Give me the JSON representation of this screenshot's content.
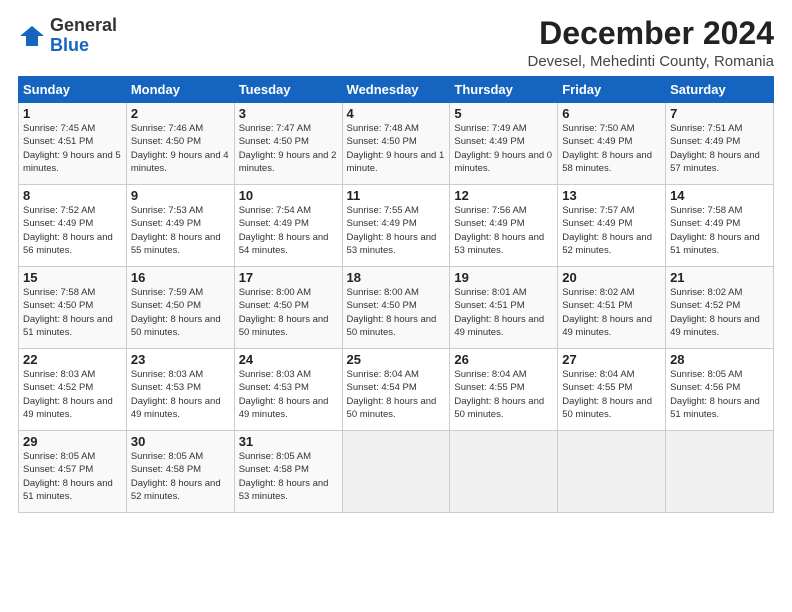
{
  "logo": {
    "general": "General",
    "blue": "Blue"
  },
  "title": "December 2024",
  "location": "Devesel, Mehedinti County, Romania",
  "weekdays": [
    "Sunday",
    "Monday",
    "Tuesday",
    "Wednesday",
    "Thursday",
    "Friday",
    "Saturday"
  ],
  "weeks": [
    [
      {
        "day": "1",
        "sunrise": "Sunrise: 7:45 AM",
        "sunset": "Sunset: 4:51 PM",
        "daylight": "Daylight: 9 hours and 5 minutes."
      },
      {
        "day": "2",
        "sunrise": "Sunrise: 7:46 AM",
        "sunset": "Sunset: 4:50 PM",
        "daylight": "Daylight: 9 hours and 4 minutes."
      },
      {
        "day": "3",
        "sunrise": "Sunrise: 7:47 AM",
        "sunset": "Sunset: 4:50 PM",
        "daylight": "Daylight: 9 hours and 2 minutes."
      },
      {
        "day": "4",
        "sunrise": "Sunrise: 7:48 AM",
        "sunset": "Sunset: 4:50 PM",
        "daylight": "Daylight: 9 hours and 1 minute."
      },
      {
        "day": "5",
        "sunrise": "Sunrise: 7:49 AM",
        "sunset": "Sunset: 4:49 PM",
        "daylight": "Daylight: 9 hours and 0 minutes."
      },
      {
        "day": "6",
        "sunrise": "Sunrise: 7:50 AM",
        "sunset": "Sunset: 4:49 PM",
        "daylight": "Daylight: 8 hours and 58 minutes."
      },
      {
        "day": "7",
        "sunrise": "Sunrise: 7:51 AM",
        "sunset": "Sunset: 4:49 PM",
        "daylight": "Daylight: 8 hours and 57 minutes."
      }
    ],
    [
      {
        "day": "8",
        "sunrise": "Sunrise: 7:52 AM",
        "sunset": "Sunset: 4:49 PM",
        "daylight": "Daylight: 8 hours and 56 minutes."
      },
      {
        "day": "9",
        "sunrise": "Sunrise: 7:53 AM",
        "sunset": "Sunset: 4:49 PM",
        "daylight": "Daylight: 8 hours and 55 minutes."
      },
      {
        "day": "10",
        "sunrise": "Sunrise: 7:54 AM",
        "sunset": "Sunset: 4:49 PM",
        "daylight": "Daylight: 8 hours and 54 minutes."
      },
      {
        "day": "11",
        "sunrise": "Sunrise: 7:55 AM",
        "sunset": "Sunset: 4:49 PM",
        "daylight": "Daylight: 8 hours and 53 minutes."
      },
      {
        "day": "12",
        "sunrise": "Sunrise: 7:56 AM",
        "sunset": "Sunset: 4:49 PM",
        "daylight": "Daylight: 8 hours and 53 minutes."
      },
      {
        "day": "13",
        "sunrise": "Sunrise: 7:57 AM",
        "sunset": "Sunset: 4:49 PM",
        "daylight": "Daylight: 8 hours and 52 minutes."
      },
      {
        "day": "14",
        "sunrise": "Sunrise: 7:58 AM",
        "sunset": "Sunset: 4:49 PM",
        "daylight": "Daylight: 8 hours and 51 minutes."
      }
    ],
    [
      {
        "day": "15",
        "sunrise": "Sunrise: 7:58 AM",
        "sunset": "Sunset: 4:50 PM",
        "daylight": "Daylight: 8 hours and 51 minutes."
      },
      {
        "day": "16",
        "sunrise": "Sunrise: 7:59 AM",
        "sunset": "Sunset: 4:50 PM",
        "daylight": "Daylight: 8 hours and 50 minutes."
      },
      {
        "day": "17",
        "sunrise": "Sunrise: 8:00 AM",
        "sunset": "Sunset: 4:50 PM",
        "daylight": "Daylight: 8 hours and 50 minutes."
      },
      {
        "day": "18",
        "sunrise": "Sunrise: 8:00 AM",
        "sunset": "Sunset: 4:50 PM",
        "daylight": "Daylight: 8 hours and 50 minutes."
      },
      {
        "day": "19",
        "sunrise": "Sunrise: 8:01 AM",
        "sunset": "Sunset: 4:51 PM",
        "daylight": "Daylight: 8 hours and 49 minutes."
      },
      {
        "day": "20",
        "sunrise": "Sunrise: 8:02 AM",
        "sunset": "Sunset: 4:51 PM",
        "daylight": "Daylight: 8 hours and 49 minutes."
      },
      {
        "day": "21",
        "sunrise": "Sunrise: 8:02 AM",
        "sunset": "Sunset: 4:52 PM",
        "daylight": "Daylight: 8 hours and 49 minutes."
      }
    ],
    [
      {
        "day": "22",
        "sunrise": "Sunrise: 8:03 AM",
        "sunset": "Sunset: 4:52 PM",
        "daylight": "Daylight: 8 hours and 49 minutes."
      },
      {
        "day": "23",
        "sunrise": "Sunrise: 8:03 AM",
        "sunset": "Sunset: 4:53 PM",
        "daylight": "Daylight: 8 hours and 49 minutes."
      },
      {
        "day": "24",
        "sunrise": "Sunrise: 8:03 AM",
        "sunset": "Sunset: 4:53 PM",
        "daylight": "Daylight: 8 hours and 49 minutes."
      },
      {
        "day": "25",
        "sunrise": "Sunrise: 8:04 AM",
        "sunset": "Sunset: 4:54 PM",
        "daylight": "Daylight: 8 hours and 50 minutes."
      },
      {
        "day": "26",
        "sunrise": "Sunrise: 8:04 AM",
        "sunset": "Sunset: 4:55 PM",
        "daylight": "Daylight: 8 hours and 50 minutes."
      },
      {
        "day": "27",
        "sunrise": "Sunrise: 8:04 AM",
        "sunset": "Sunset: 4:55 PM",
        "daylight": "Daylight: 8 hours and 50 minutes."
      },
      {
        "day": "28",
        "sunrise": "Sunrise: 8:05 AM",
        "sunset": "Sunset: 4:56 PM",
        "daylight": "Daylight: 8 hours and 51 minutes."
      }
    ],
    [
      {
        "day": "29",
        "sunrise": "Sunrise: 8:05 AM",
        "sunset": "Sunset: 4:57 PM",
        "daylight": "Daylight: 8 hours and 51 minutes."
      },
      {
        "day": "30",
        "sunrise": "Sunrise: 8:05 AM",
        "sunset": "Sunset: 4:58 PM",
        "daylight": "Daylight: 8 hours and 52 minutes."
      },
      {
        "day": "31",
        "sunrise": "Sunrise: 8:05 AM",
        "sunset": "Sunset: 4:58 PM",
        "daylight": "Daylight: 8 hours and 53 minutes."
      },
      null,
      null,
      null,
      null
    ]
  ]
}
